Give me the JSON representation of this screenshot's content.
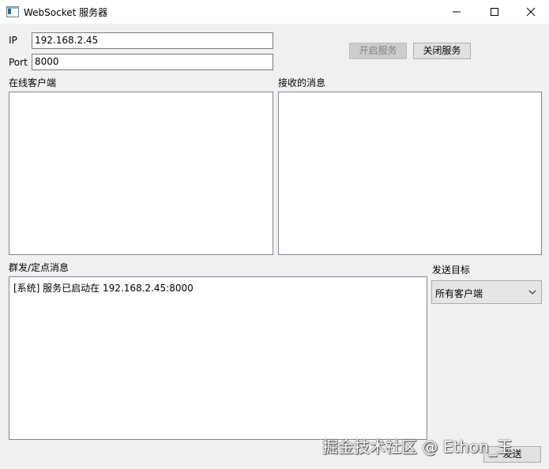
{
  "window": {
    "title": "WebSocket 服务器",
    "controls": {
      "minimize_icon": "minimize-icon",
      "maximize_icon": "maximize-icon",
      "close_icon": "close-icon"
    }
  },
  "connection": {
    "ip_label": "IP",
    "ip_value": "192.168.2.45",
    "port_label": "Port",
    "port_value": "8000",
    "start_button": "开启服务",
    "stop_button": "关闭服务"
  },
  "panels": {
    "clients_label": "在线客户端",
    "clients": [],
    "received_label": "接收的消息",
    "received": []
  },
  "broadcast": {
    "label": "群发/定点消息",
    "log": [
      "[系统] 服务已启动在 192.168.2.45:8000"
    ],
    "target_label": "发送目标",
    "target_selected": "所有客户端",
    "send_button": "发送"
  },
  "watermark": "掘金技术社区 @ Ethon_王",
  "colors": {
    "window_bg": "#f0f0f0",
    "titlebar_bg": "#ffffff",
    "disabled_button_bg": "#cccccc",
    "button_bg": "#e1e1e1"
  }
}
